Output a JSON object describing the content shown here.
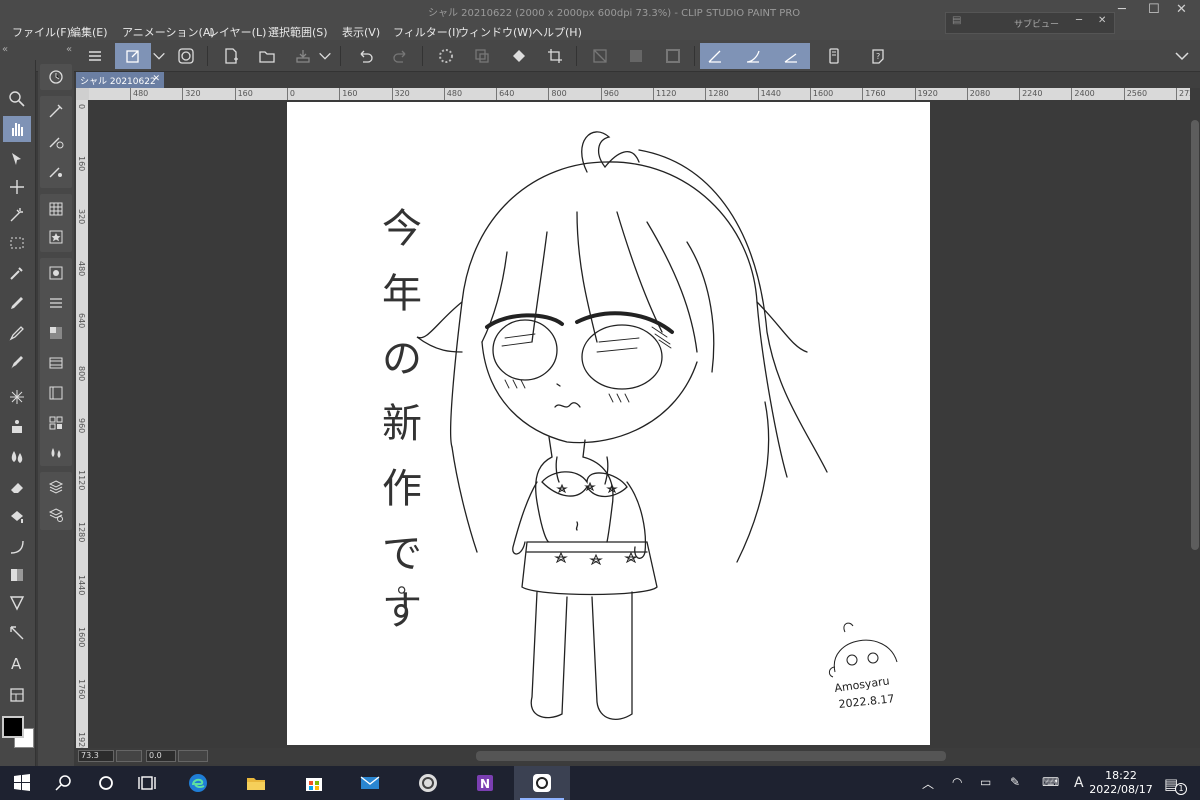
{
  "window": {
    "title": "シャル 20210622 (2000 x 2000px 600dpi 73.3%)  - CLIP STUDIO PAINT PRO",
    "subview_label": "サブビュー"
  },
  "menu": [
    "ファイル(F)",
    "編集(E)",
    "アニメーション(A)",
    "レイヤー(L)",
    "選択範囲(S)",
    "表示(V)",
    "フィルター(I)",
    "ウィンドウ(W)",
    "ヘルプ(H)"
  ],
  "tab": {
    "label": "シャル 20210622",
    "close": "✕"
  },
  "ruler_h": [
    "480",
    "320",
    "160",
    "0",
    "160",
    "320",
    "480",
    "640",
    "800",
    "960",
    "1120",
    "1280",
    "1440",
    "1600",
    "1760",
    "1920",
    "2080",
    "2240",
    "2400",
    "2560",
    "2720"
  ],
  "ruler_v": [
    "0",
    "160",
    "320",
    "480",
    "640",
    "800",
    "960",
    "1120",
    "1280",
    "1440",
    "1600",
    "1760",
    "1920"
  ],
  "status": {
    "zoom": "73.3",
    "angle": "0.0"
  },
  "artwork": {
    "vertical_text": [
      "今",
      "年",
      "の",
      "新",
      "作",
      "で",
      "す",
      "。"
    ],
    "signature": "Amosyaru",
    "date": "2022.8.17"
  },
  "taskbar": {
    "time": "18:22",
    "date": "2022/08/17",
    "ime": "A",
    "notifications": "1"
  },
  "colors": {
    "accent": "#7f93b6",
    "tab_active": "#6b7fa3",
    "taskbar": "#1e2230",
    "edge": "#1f7ed6",
    "onenote": "#7b3fb2",
    "mail": "#2a86d1",
    "explorer": "#e9b73c"
  },
  "icons": {
    "toolbar": [
      "menu-icon",
      "quick-access-icon",
      "clip-studio-icon",
      "new-file-icon",
      "open-icon",
      "export-icon",
      "undo-icon",
      "redo-icon",
      "loading-icon",
      "transform-icon",
      "fill-icon",
      "crop-icon",
      "clear-icon",
      "tone-icon",
      "frame-icon",
      "pen-stabilizer-icon",
      "brush-icon",
      "ruler-icon",
      "tablet-icon",
      "help-icon"
    ]
  }
}
